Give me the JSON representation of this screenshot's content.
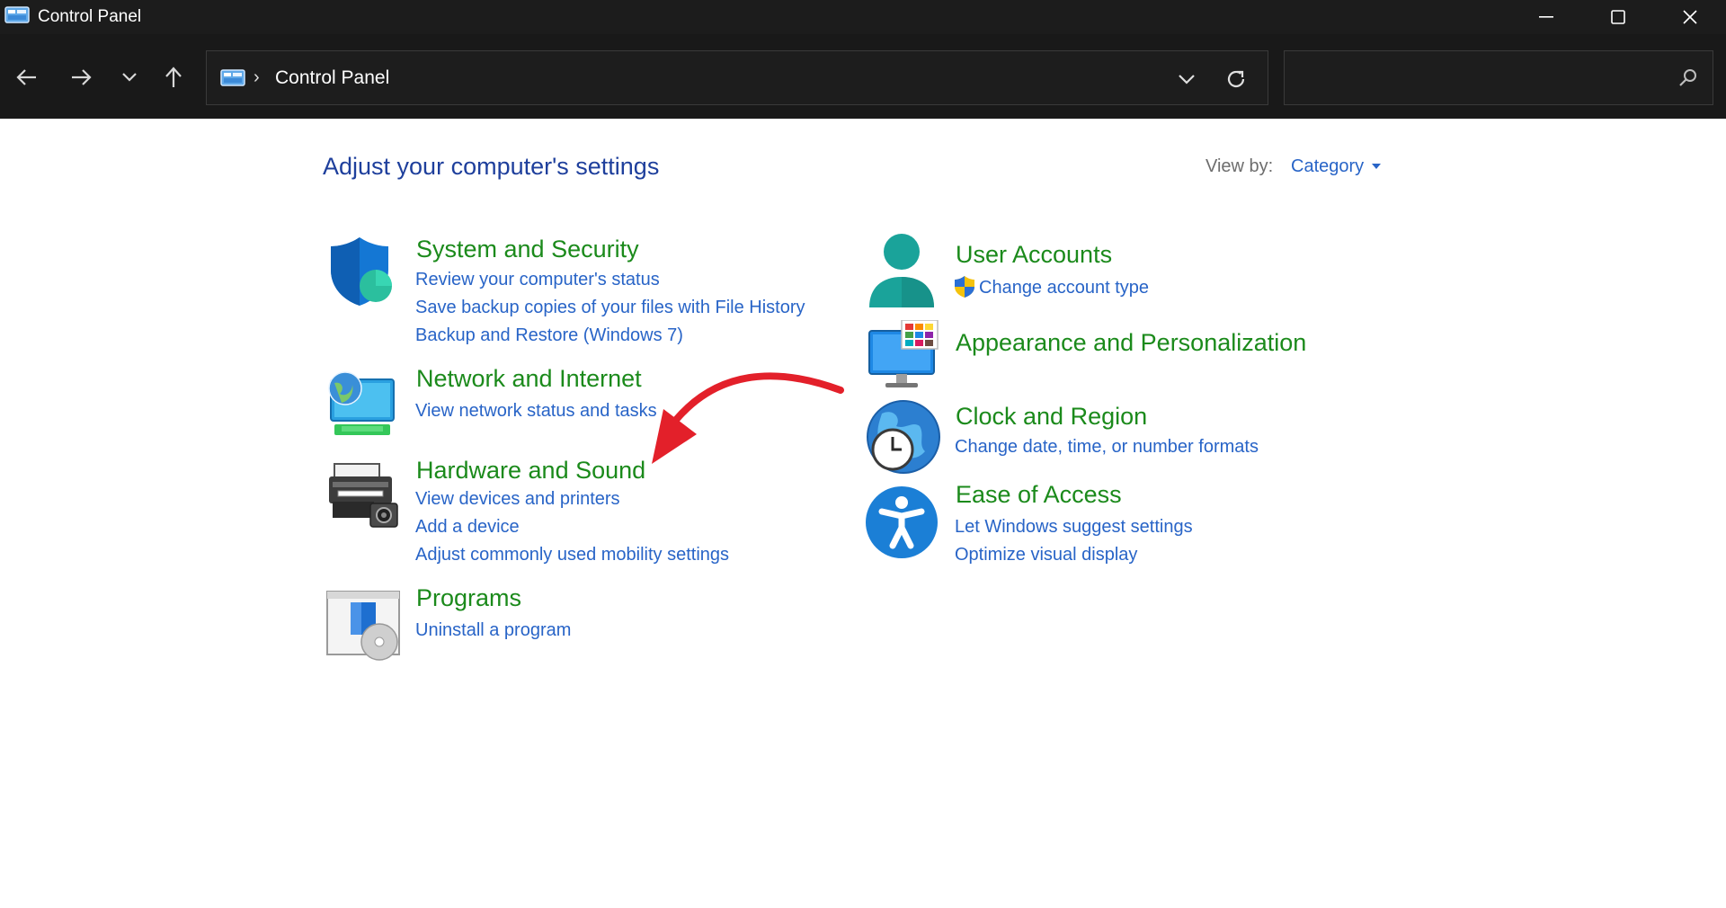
{
  "window": {
    "title": "Control Panel",
    "accent": "#1c1c1c"
  },
  "toolbar": {
    "breadcrumb": "Control Panel",
    "search_placeholder": ""
  },
  "main": {
    "heading": "Adjust your computer's settings",
    "view_by_label": "View by:",
    "view_by_value": "Category"
  },
  "categories": {
    "system": {
      "title": "System and Security",
      "icon": "shield-icon",
      "links": [
        "Review your computer's status",
        "Save backup copies of your files with File History",
        "Backup and Restore (Windows 7)"
      ]
    },
    "network": {
      "title": "Network and Internet",
      "icon": "network-globe-icon",
      "links": [
        "View network status and tasks"
      ]
    },
    "hardware": {
      "title": "Hardware and Sound",
      "icon": "printer-icon",
      "links": [
        "View devices and printers",
        "Add a device",
        "Adjust commonly used mobility settings"
      ]
    },
    "programs": {
      "title": "Programs",
      "icon": "programs-disc-icon",
      "links": [
        "Uninstall a program"
      ]
    },
    "users": {
      "title": "User Accounts",
      "icon": "user-icon",
      "links": [
        "Change account type"
      ]
    },
    "appearance": {
      "title": "Appearance and Personalization",
      "icon": "monitor-colors-icon",
      "links": []
    },
    "clock": {
      "title": "Clock and Region",
      "icon": "clock-globe-icon",
      "links": [
        "Change date, time, or number formats"
      ]
    },
    "ease": {
      "title": "Ease of Access",
      "icon": "accessibility-icon",
      "links": [
        "Let Windows suggest settings",
        "Optimize visual display"
      ]
    }
  },
  "colors": {
    "heading_blue": "#1e3f9c",
    "category_green": "#1b8a1b",
    "link_blue": "#2864c7",
    "annotation_red": "#e3202a"
  }
}
